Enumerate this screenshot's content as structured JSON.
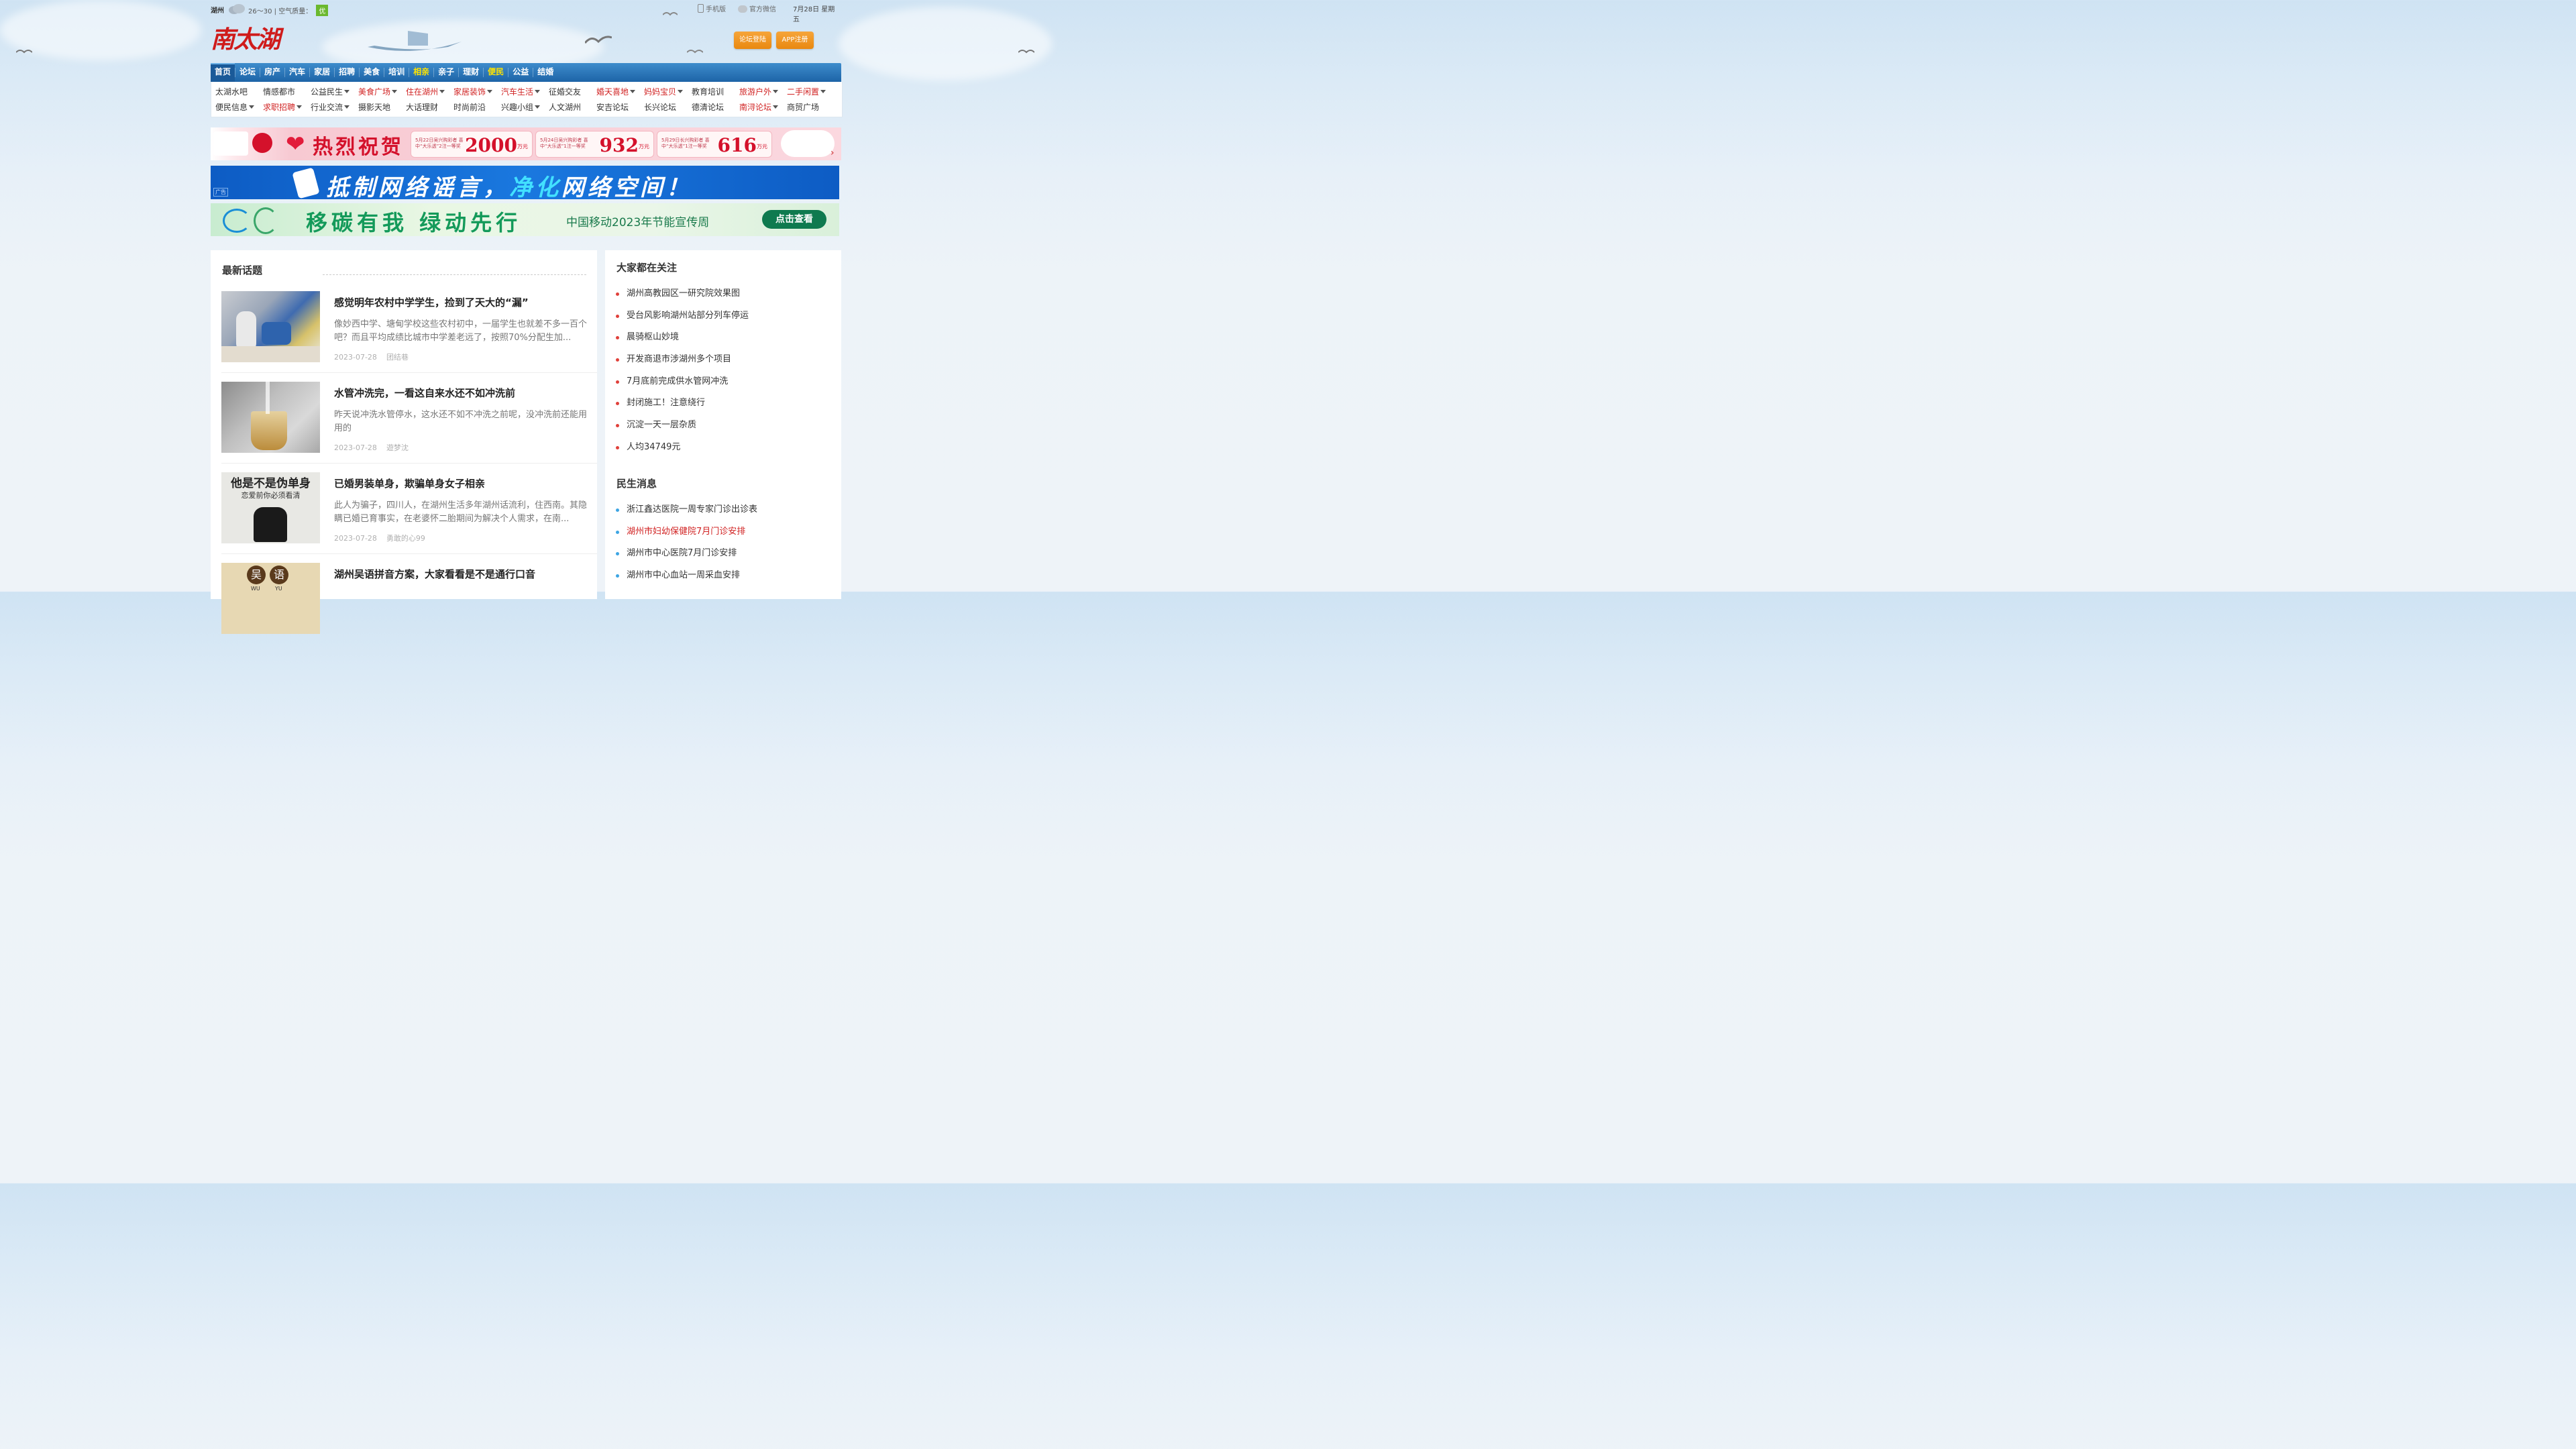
{
  "topbar": {
    "city": "湖州",
    "temp": "26～30",
    "aq_label": "| 空气质量：",
    "aq_value": "优",
    "mobile": "手机版",
    "wechat": "官方微信",
    "date": "7月28日 星期五"
  },
  "logo": "南太湖",
  "auth": {
    "forum_login": "论坛登陆",
    "app_register": "APP注册"
  },
  "nav": [
    {
      "label": "首页",
      "style": "active"
    },
    {
      "label": "论坛",
      "style": ""
    },
    {
      "label": "房产",
      "style": ""
    },
    {
      "label": "汽车",
      "style": ""
    },
    {
      "label": "家居",
      "style": ""
    },
    {
      "label": "招聘",
      "style": ""
    },
    {
      "label": "美食",
      "style": ""
    },
    {
      "label": "培训",
      "style": ""
    },
    {
      "label": "相亲",
      "style": "yellow"
    },
    {
      "label": "亲子",
      "style": ""
    },
    {
      "label": "理财",
      "style": ""
    },
    {
      "label": "便民",
      "style": "yellow"
    },
    {
      "label": "公益",
      "style": ""
    },
    {
      "label": "结婚",
      "style": ""
    }
  ],
  "subnav": [
    [
      {
        "label": "太湖水吧",
        "red": false,
        "caret": false
      },
      {
        "label": "情感都市",
        "red": false,
        "caret": false
      },
      {
        "label": "公益民生",
        "red": false,
        "caret": true
      },
      {
        "label": "美食广场",
        "red": true,
        "caret": true
      },
      {
        "label": "住在湖州",
        "red": true,
        "caret": true
      },
      {
        "label": "家居装饰",
        "red": true,
        "caret": true
      },
      {
        "label": "汽车生活",
        "red": true,
        "caret": true
      },
      {
        "label": "征婚交友",
        "red": false,
        "caret": false
      },
      {
        "label": "婚天喜地",
        "red": true,
        "caret": true
      },
      {
        "label": "妈妈宝贝",
        "red": true,
        "caret": true
      },
      {
        "label": "教育培训",
        "red": false,
        "caret": false
      },
      {
        "label": "旅游户外",
        "red": true,
        "caret": true
      },
      {
        "label": "二手闲置",
        "red": true,
        "caret": true
      }
    ],
    [
      {
        "label": "便民信息",
        "red": false,
        "caret": true
      },
      {
        "label": "求职招聘",
        "red": true,
        "caret": true
      },
      {
        "label": "行业交流",
        "red": false,
        "caret": true
      },
      {
        "label": "摄影天地",
        "red": false,
        "caret": false
      },
      {
        "label": "大话理财",
        "red": false,
        "caret": false
      },
      {
        "label": "时尚前沿",
        "red": false,
        "caret": false
      },
      {
        "label": "兴趣小组",
        "red": false,
        "caret": true
      },
      {
        "label": "人文湖州",
        "red": false,
        "caret": false
      },
      {
        "label": "安吉论坛",
        "red": false,
        "caret": false
      },
      {
        "label": "长兴论坛",
        "red": false,
        "caret": false
      },
      {
        "label": "德清论坛",
        "red": false,
        "caret": false
      },
      {
        "label": "南浔论坛",
        "red": true,
        "caret": true
      },
      {
        "label": "商贸广场",
        "red": false,
        "caret": false
      }
    ]
  ],
  "banners": {
    "b1_title": "热烈祝贺",
    "b1_prizes": [
      {
        "desc": "5月22日吴兴购彩者 喜中“大乐透”2注一等奖",
        "num": "2000",
        "unit": "万元"
      },
      {
        "desc": "5月24日吴兴购彩者 喜中“大乐透”1注一等奖",
        "num": "932",
        "unit": "万元"
      },
      {
        "desc": "5月29日长兴购彩者 喜中“大乐透”1注一等奖",
        "num": "616",
        "unit": "万元"
      }
    ],
    "b2_part1": "抵制网络谣言，",
    "b2_part2": "净化",
    "b2_part3": "网络空间！",
    "b2_ad": "广告",
    "b3_big": "移碳有我  绿动先行",
    "b3_small": "中国移动2023年节能宣传周",
    "b3_cta": "点击查看"
  },
  "latest": {
    "title": "最新话题",
    "articles": [
      {
        "title": "感觉明年农村中学学生，捡到了天大的“漏”",
        "summary": "像妙西中学、塘甸学校这些农村初中，一届学生也就差不多一百个吧？而且平均成绩比城市中学差老远了，按照70%分配生加...",
        "date": "2023-07-28",
        "author": "团结巷"
      },
      {
        "title": "水管冲洗完，一看这自来水还不如冲洗前",
        "summary": "昨天说冲洗水管停水，这水还不如不冲洗之前呢，没冲洗前还能用用的",
        "date": "2023-07-28",
        "author": "遊梦沈"
      },
      {
        "title": "已婚男装单身，欺骗单身女子相亲",
        "summary": "此人为骗子，四川人，在湖州生活多年湖州话流利，住西南。其隐瞒已婚已育事实，在老婆怀二胎期间为解决个人需求，在南...",
        "date": "2023-07-28",
        "author": "勇敢的心99"
      },
      {
        "title": "湖州吴语拼音方案，大家看看是不是通行口音",
        "summary": "",
        "date": "",
        "author": ""
      }
    ],
    "thumb3_line1": "他是不是伪单身",
    "thumb3_line2": "恋爱前你必须看清",
    "thumb4_chars": [
      "吴",
      "语"
    ],
    "thumb4_pinyin": [
      "WU",
      "YU"
    ]
  },
  "focus": {
    "title": "大家都在关注",
    "items": [
      "湖州高教园区一研究院效果图",
      "受台风影响湖州站部分列车停运",
      "晨骑枢山妙境",
      "开发商退市涉湖州多个项目",
      "7月底前完成供水管网冲洗",
      "封闭施工！注意绕行",
      "沉淀一天一层杂质",
      "人均34749元"
    ]
  },
  "minsheng": {
    "title": "民生消息",
    "items": [
      {
        "label": "浙江鑫达医院一周专家门诊出诊表",
        "hl": false
      },
      {
        "label": "湖州市妇幼保健院7月门诊安排",
        "hl": true
      },
      {
        "label": "湖州市中心医院7月门诊安排",
        "hl": false
      },
      {
        "label": "湖州市中心血站一周采血安排",
        "hl": false
      }
    ]
  }
}
